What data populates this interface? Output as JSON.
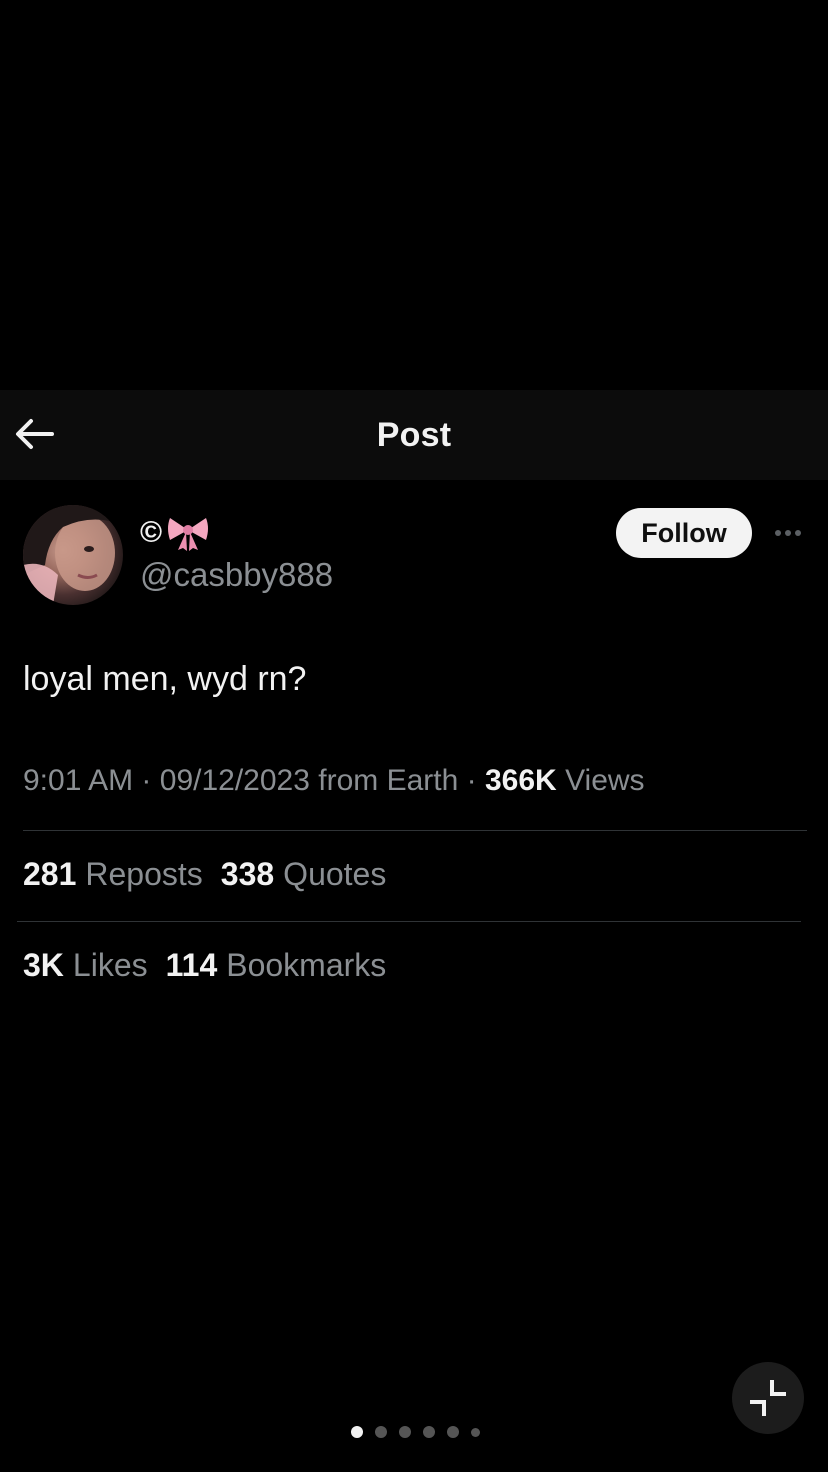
{
  "header": {
    "title": "Post",
    "back_icon": "arrow-left-icon"
  },
  "post": {
    "author": {
      "display_name": "©",
      "display_name_emoji": "pink-bow-icon",
      "handle": "@casbby888"
    },
    "follow_label": "Follow",
    "more_icon": "more-horizontal-icon",
    "text": "loyal men, wyd rn?",
    "meta": {
      "time": "9:01 AM",
      "separator": "·",
      "date": "09/12/2023",
      "source": "from Earth",
      "views_count": "366K",
      "views_label": "Views"
    },
    "stats": {
      "reposts": {
        "count": "281",
        "label": "Reposts"
      },
      "quotes": {
        "count": "338",
        "label": "Quotes"
      },
      "likes": {
        "count": "3K",
        "label": "Likes"
      },
      "bookmarks": {
        "count": "114",
        "label": "Bookmarks"
      }
    }
  },
  "collapse_icon": "collapse-icon",
  "pager": {
    "total": 6,
    "active_index": 0
  },
  "colors": {
    "background": "#000000",
    "header_bg": "#0c0c0c",
    "primary_text": "#f2f2f2",
    "secondary_text": "#8b8f93",
    "divider": "#2f3336",
    "follow_bg": "#f3f3f3",
    "bow": "#f4a7c0"
  }
}
